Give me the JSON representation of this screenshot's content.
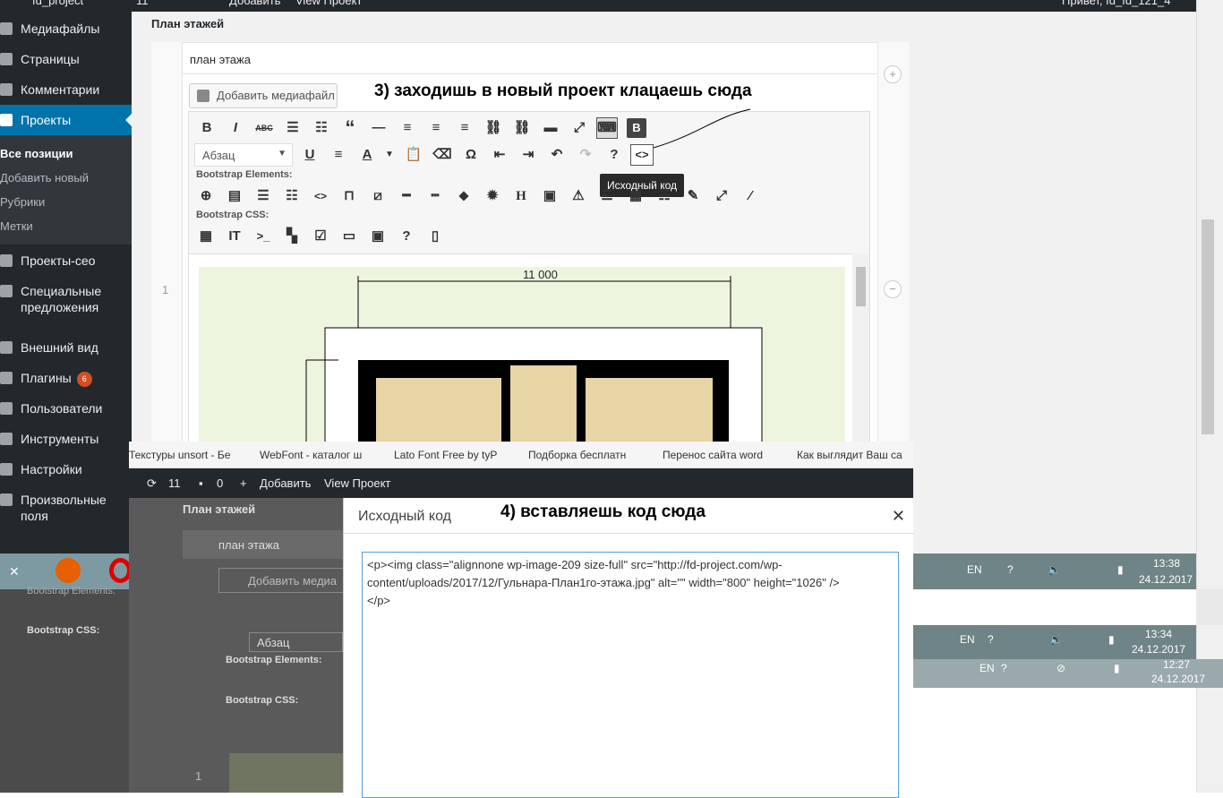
{
  "topbar": {
    "site": "fd_project",
    "updates": "11",
    "add": "Добавить",
    "view": "View Проект",
    "greeting": "Привет, fd_fd_121_4"
  },
  "sidebar": {
    "items": [
      {
        "label": "Медиафайлы"
      },
      {
        "label": "Страницы"
      },
      {
        "label": "Комментарии"
      },
      {
        "label": "Проекты"
      },
      {
        "label": "Проекты-сео"
      },
      {
        "label": "Специальные предложения"
      },
      {
        "label": "Внешний вид"
      },
      {
        "label": "Плагины",
        "badge": "6"
      },
      {
        "label": "Пользователи"
      },
      {
        "label": "Инструменты"
      },
      {
        "label": "Настройки"
      },
      {
        "label": "Произвольные поля"
      }
    ],
    "subitems": [
      "Все позиции",
      "Добавить новый",
      "Рубрики",
      "Метки"
    ]
  },
  "main": {
    "section_title": "План этажей",
    "field_label": "план этажа",
    "add_media": "Добавить медиафайл",
    "format_select": "Абзац",
    "bootstrap_elements": "Bootstrap Elements:",
    "bootstrap_css": "Bootstrap CSS:",
    "row_number": "1",
    "dimension": "11 000",
    "annotation_3": "3) заходишь в новый проект клацаешь сюда",
    "tooltip": "Исходный код"
  },
  "bookmarks": [
    "Текстуры unsort - Бе",
    "WebFont - каталог ш",
    "Lato Font Free by tyP",
    "Подборка бесплатн",
    "Перенос сайта word",
    "Как выглядит Ваш са"
  ],
  "adminbar2": {
    "updates": "11",
    "comments": "0",
    "add": "Добавить",
    "view": "View Проект"
  },
  "background": {
    "section_title": "План этажей",
    "field_label": "план этажа",
    "add_media": "Добавить медиа",
    "format_select": "Абзац",
    "bootstrap_elements": "Bootstrap Elements:",
    "bootstrap_css": "Bootstrap CSS:",
    "row_number": "1"
  },
  "modal": {
    "title": "Исходный код",
    "annotation_4": "4) вставляешь код сюда",
    "code_line1": "<p><img class=\"alignnone wp-image-209 size-full\" src=\"http://fd-project.com/wp-",
    "code_line2": "content/uploads/2017/12/Гульнара-План1го-этажа.jpg\" alt=\"\" width=\"800\" height=\"1026\" />",
    "code_line3": "</p>"
  },
  "taskbars": [
    {
      "lang": "EN",
      "time": "13:38",
      "date": "24.12.2017"
    },
    {
      "lang": "EN",
      "time": "13:34",
      "date": "24.12.2017"
    },
    {
      "lang": "EN",
      "time": "12:27",
      "date": "24.12.2017"
    }
  ]
}
